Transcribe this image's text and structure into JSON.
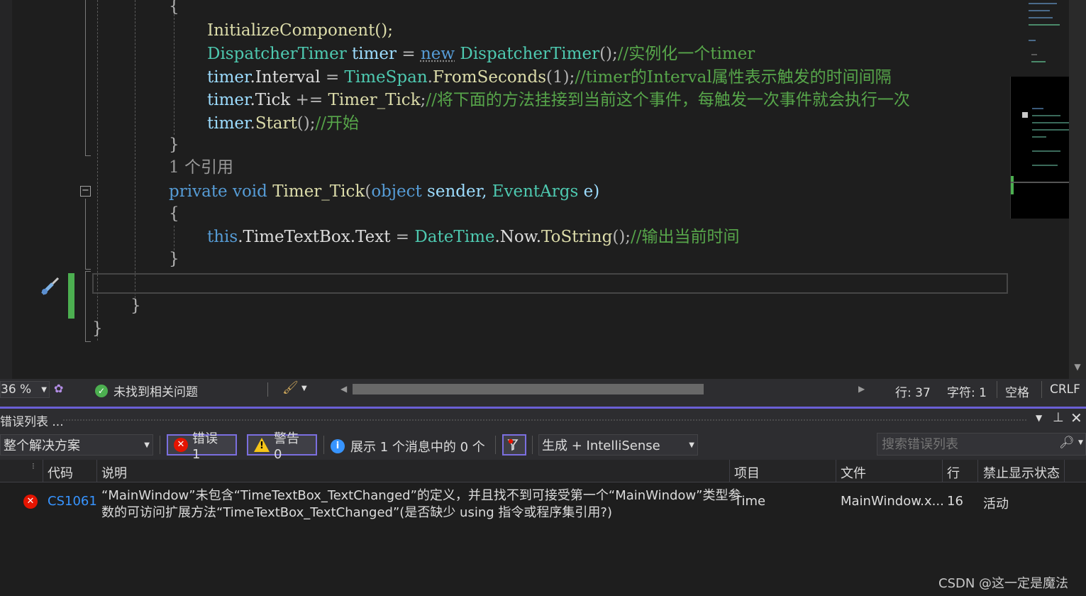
{
  "code": {
    "l1": "InitializeComponent();",
    "l2a": "DispatcherTimer",
    "l2b": " timer ",
    "l2c": "= ",
    "l2d": "new",
    "l2e": " DispatcherTimer",
    "l2f": "();",
    "l2g": "//实例化一个timer",
    "l3a": "timer",
    "l3b": ".Interval ",
    "l3c": "= ",
    "l3d": "TimeSpan",
    "l3e": ".",
    "l3f": "FromSeconds",
    "l3g": "(1);",
    "l3h": "//timer的Interval属性表示触发的时间间隔",
    "l4a": "timer",
    "l4b": ".Tick ",
    "l4c": "+= ",
    "l4d": "Timer_Tick",
    "l4e": ";",
    "l4f": "//将下面的方法挂接到当前这个事件，每触发一次事件就会执行一次",
    "l5a": "timer",
    "l5b": ".",
    "l5c": "Start",
    "l5d": "();",
    "l5e": "//开始",
    "codelens": "1 个引用",
    "l7a": "private",
    "l7b": " void ",
    "l7c": "Timer_Tick",
    "l7d": "(",
    "l7e": "object",
    "l7f": " sender, ",
    "l7g": "EventArgs",
    "l7h": " e)",
    "l9a": "this",
    "l9b": ".TimeTextBox.Text ",
    "l9c": "= ",
    "l9d": "DateTime",
    "l9e": ".Now.",
    "l9f": "ToString",
    "l9g": "();",
    "l9h": "//输出当前时间",
    "open_brace": "{",
    "close_brace": "}"
  },
  "status": {
    "zoom": "36 %",
    "no_issues": "未找到相关问题",
    "line": "行: 37",
    "char": "字符: 1",
    "spaces": "空格",
    "eol": "CRLF"
  },
  "error_list": {
    "title": "错误列表 ...",
    "scope": "整个解决方案",
    "errors": "错误 1",
    "warnings": "警告 0",
    "messages": "展示 1 个消息中的 0 个",
    "build_filter": "生成 + IntelliSense",
    "search_placeholder": "搜索错误列表",
    "columns": {
      "code": "代码",
      "desc": "说明",
      "project": "项目",
      "file": "文件",
      "line": "行",
      "suppress": "禁止显示状态"
    },
    "rows": [
      {
        "code": "CS1061",
        "desc1": "“MainWindow”未包含“TimeTextBox_TextChanged”的定义，并且找不到可接受第一个“MainWindow”类型参",
        "desc2": "数的可访问扩展方法“TimeTextBox_TextChanged”(是否缺少 using 指令或程序集引用?)",
        "project": "Time",
        "file": "MainWindow.x...",
        "line": "16",
        "suppress": "活动"
      }
    ]
  },
  "watermark": "CSDN @这一定是魔法",
  "colors": {
    "keyword": "#569cd6",
    "type": "#4ec9b0",
    "comment": "#57a64a",
    "method": "#dcdcaa",
    "accent": "#7b6fe0",
    "error": "#e51400"
  },
  "icons": {
    "error": "error-icon",
    "warning": "warning-icon",
    "info": "info-icon",
    "filter": "filter-icon",
    "search": "search-icon",
    "screwdriver": "screwdriver-icon",
    "check": "check-icon",
    "brush": "brush-icon",
    "pin": "pin-icon",
    "close": "close-icon"
  }
}
